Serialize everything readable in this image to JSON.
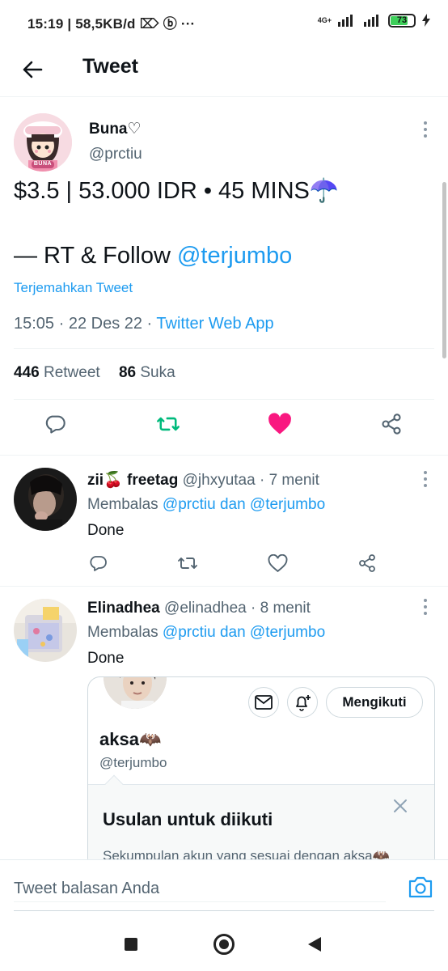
{
  "status_bar": {
    "text": "15:19 | 58,5KB/d ⌦ ⓑ  ···",
    "network": "4G+",
    "battery": "73"
  },
  "header": {
    "title": "Tweet"
  },
  "tweet": {
    "author_name": "Buna♡",
    "author_handle": "@prctiu",
    "avatar_badge": "BUNA",
    "line1": "$3.5 | 53.000 IDR • 45 MINS☂️",
    "line2_prefix": "— RT & Follow ",
    "line2_mention": "@terjumbo",
    "translate": "Terjemahkan Tweet",
    "meta_time": "15:05 · 22 Des 22 · ",
    "meta_source": "Twitter Web App",
    "retweets_count": "446",
    "retweets_label": " Retweet",
    "likes_count": "86",
    "likes_label": " Suka"
  },
  "replies": [
    {
      "name": "zii🍒 freetag",
      "handle": " @jhxyutaa · 7 menit",
      "reply_prefix": "Membalas ",
      "reply_mentions": "@prctiu dan @terjumbo",
      "text": "Done"
    },
    {
      "name": "Elinadhea",
      "handle": " @elinadhea · 8 menit",
      "reply_prefix": "Membalas ",
      "reply_mentions": "@prctiu dan @terjumbo",
      "text": "Done"
    }
  ],
  "profile_card": {
    "name": "aksa🦇",
    "handle": "@terjumbo",
    "follow_label": "Mengikuti",
    "suggest_title": "Usulan untuk diikuti",
    "suggest_sub": "Sekumpulan akun yang sesuai dengan aksa🦇"
  },
  "composer": {
    "placeholder": "Tweet balasan Anda"
  },
  "colors": {
    "accent": "#1d9bf0",
    "retweet": "#00ba7c",
    "like": "#f91880",
    "text": "#0f1419",
    "secondary": "#536471"
  },
  "icons": [
    "back-arrow-icon",
    "more-icon",
    "reply-icon",
    "retweet-icon",
    "heart-icon",
    "share-icon",
    "mail-icon",
    "bell-plus-icon",
    "close-icon",
    "camera-icon"
  ]
}
